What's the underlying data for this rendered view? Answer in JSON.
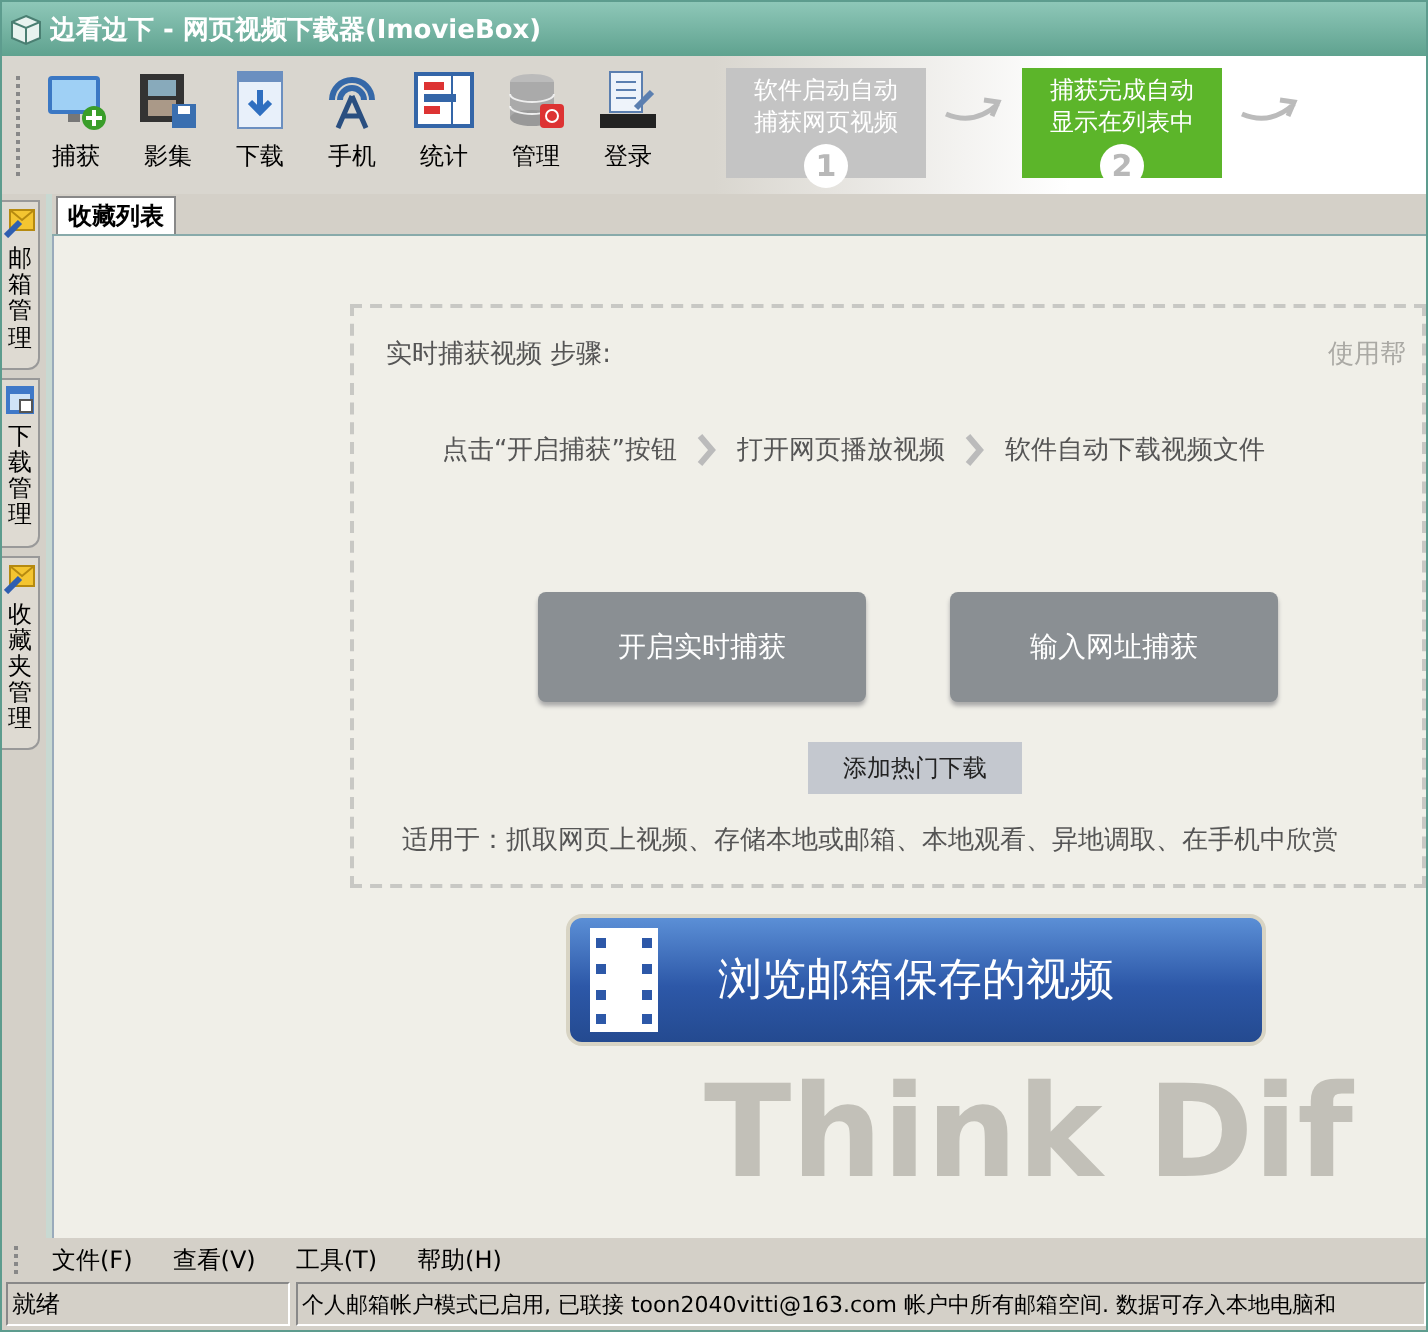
{
  "window": {
    "title": "边看边下 - 网页视频下载器(ImovieBox)"
  },
  "toolbar": {
    "buttons": [
      {
        "label": "捕获",
        "kind": "capture"
      },
      {
        "label": "影集",
        "kind": "album"
      },
      {
        "label": "下载",
        "kind": "download"
      },
      {
        "label": "手机",
        "kind": "phone"
      },
      {
        "label": "统计",
        "kind": "stats"
      },
      {
        "label": "管理",
        "kind": "manage"
      },
      {
        "label": "登录",
        "kind": "login"
      }
    ]
  },
  "banner": {
    "steps": [
      {
        "lines": [
          "软件启动自动",
          "捕获网页视频"
        ],
        "number": "1",
        "selected": false
      },
      {
        "lines": [
          "捕获完成自动",
          "显示在列表中"
        ],
        "number": "2",
        "selected": true
      }
    ]
  },
  "tabs": [
    {
      "label": "收藏列表",
      "selected": true
    }
  ],
  "side_tabs": [
    {
      "label": "邮箱管理",
      "kind": "mail"
    },
    {
      "label": "下载管理",
      "kind": "download"
    },
    {
      "label": "收藏夹管理",
      "kind": "mail"
    }
  ],
  "capture_panel": {
    "heading": "实时捕获视频 步骤:",
    "help_link": "使用帮",
    "steps": [
      "点击“开启捕获”按钮",
      "打开网页播放视频",
      "软件自动下载视频文件"
    ],
    "buttons": [
      "开启实时捕获",
      "输入网址捕获"
    ],
    "secondary_button": "添加热门下载",
    "note": "适用于：抓取网页上视频、存储本地或邮箱、本地观看、异地调取、在手机中欣赏"
  },
  "browse_button": "浏览邮箱保存的视频",
  "background_text": "Think Dif",
  "menu": [
    "文件(F)",
    "查看(V)",
    "工具(T)",
    "帮助(H)"
  ],
  "status_bar": {
    "state": "就绪",
    "message": "个人邮箱帐户模式已启用, 已联接 toon2040vitti@163.com 帐户中所有邮箱空间. 数据可存入本地电脑和"
  }
}
